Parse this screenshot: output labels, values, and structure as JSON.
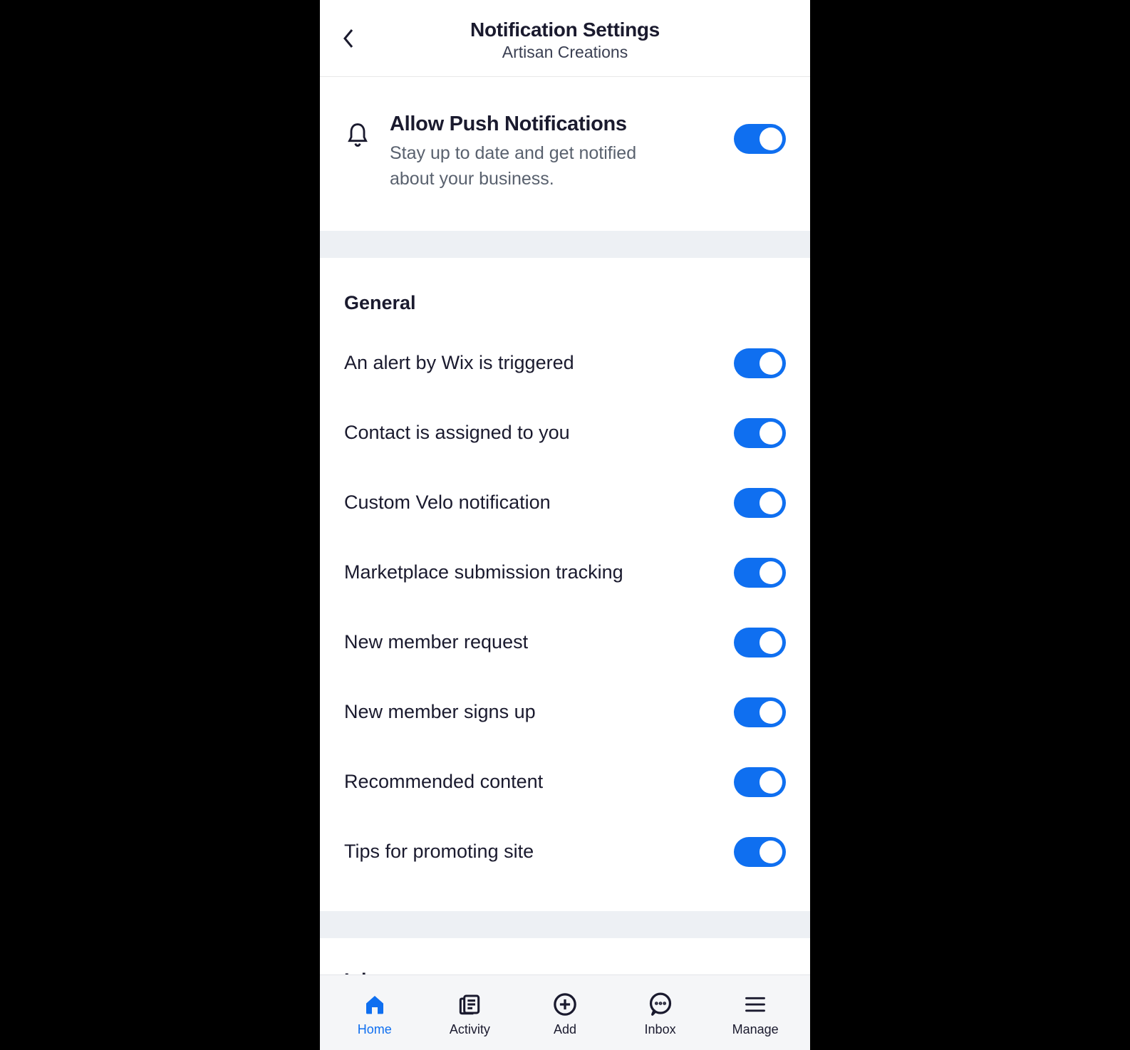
{
  "header": {
    "title": "Notification Settings",
    "subtitle": "Artisan Creations"
  },
  "push_notifications": {
    "title": "Allow Push Notifications",
    "description": "Stay up to date and get notified about your business.",
    "enabled": true
  },
  "sections": [
    {
      "title": "General",
      "items": [
        {
          "label": "An alert by Wix is triggered",
          "enabled": true
        },
        {
          "label": "Contact is assigned to you",
          "enabled": true
        },
        {
          "label": "Custom Velo notification",
          "enabled": true
        },
        {
          "label": "Marketplace submission tracking",
          "enabled": true
        },
        {
          "label": "New member request",
          "enabled": true
        },
        {
          "label": "New member signs up",
          "enabled": true
        },
        {
          "label": "Recommended content",
          "enabled": true
        },
        {
          "label": "Tips for promoting site",
          "enabled": true
        }
      ]
    },
    {
      "title": "Inbox",
      "items": []
    }
  ],
  "bottom_nav": {
    "items": [
      {
        "label": "Home",
        "icon": "home-icon",
        "active": true
      },
      {
        "label": "Activity",
        "icon": "activity-icon",
        "active": false
      },
      {
        "label": "Add",
        "icon": "add-icon",
        "active": false
      },
      {
        "label": "Inbox",
        "icon": "inbox-icon",
        "active": false
      },
      {
        "label": "Manage",
        "icon": "manage-icon",
        "active": false
      }
    ]
  },
  "colors": {
    "accent": "#0f6ff0",
    "text_primary": "#1a1a2e",
    "text_secondary": "#59616e",
    "divider": "#edf0f4"
  }
}
